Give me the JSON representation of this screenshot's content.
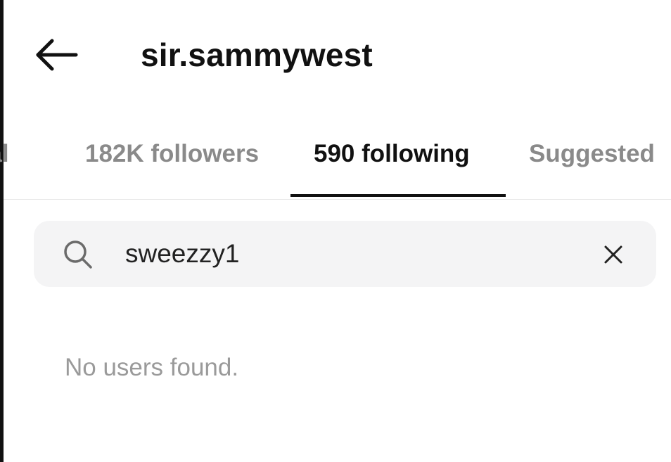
{
  "header": {
    "title": "sir.sammywest",
    "back_icon": "arrow-left-icon"
  },
  "tabs": [
    {
      "label": "ual",
      "active": false
    },
    {
      "label": "182K followers",
      "active": false
    },
    {
      "label": "590 following",
      "active": true
    },
    {
      "label": "Suggested",
      "active": false
    }
  ],
  "search": {
    "value": "sweezzy1",
    "icon": "search-icon",
    "clear_icon": "close-icon"
  },
  "empty_state": {
    "message": "No users found."
  },
  "colors": {
    "text_primary": "#111111",
    "text_secondary": "#8a8a8a",
    "search_bg": "#f4f4f5",
    "accent_underline": "#111111"
  }
}
